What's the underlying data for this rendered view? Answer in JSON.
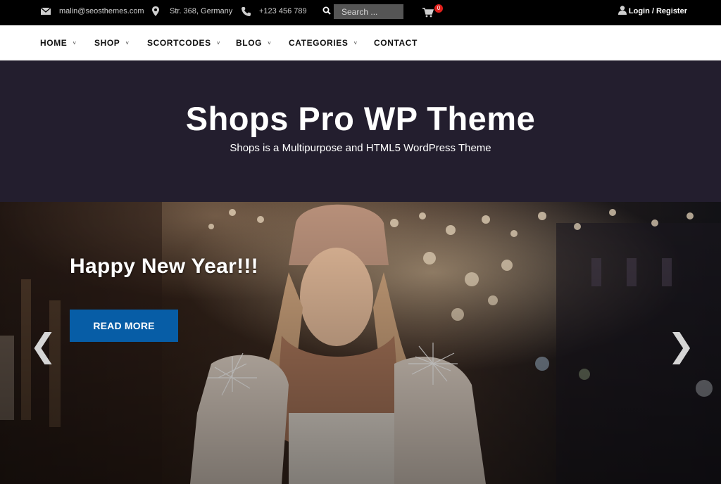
{
  "topbar": {
    "email": "malin@seosthemes.com",
    "address": "Str. 368, Germany",
    "phone": "+123 456 789",
    "search_placeholder": "Search ...",
    "cart_count": "0",
    "login": "Login / Register",
    "icons": [
      "envelope-icon",
      "map-pin-icon",
      "phone-icon",
      "search-icon",
      "cart-icon",
      "user-icon"
    ]
  },
  "nav": {
    "items": [
      {
        "label": "HOME",
        "dropdown": true
      },
      {
        "label": "SHOP",
        "dropdown": true
      },
      {
        "label": "SCORTCODES",
        "dropdown": true
      },
      {
        "label": "BLOG",
        "dropdown": true
      },
      {
        "label": "CATEGORIES",
        "dropdown": true
      },
      {
        "label": "CONTACT",
        "dropdown": false
      }
    ],
    "chevron": "˅"
  },
  "banner": {
    "title": "Shops Pro WP Theme",
    "subtitle": "Shops is a Multipurpose and HTML5 WordPress Theme"
  },
  "hero": {
    "heading": "Happy New Year!!!",
    "button": "READ MORE",
    "prev": "❮",
    "next": "❯"
  },
  "colors": {
    "topbar_bg": "#000000",
    "banner_bg": "#231e2e",
    "button_bg": "#075da6",
    "badge": "#e0201c"
  }
}
